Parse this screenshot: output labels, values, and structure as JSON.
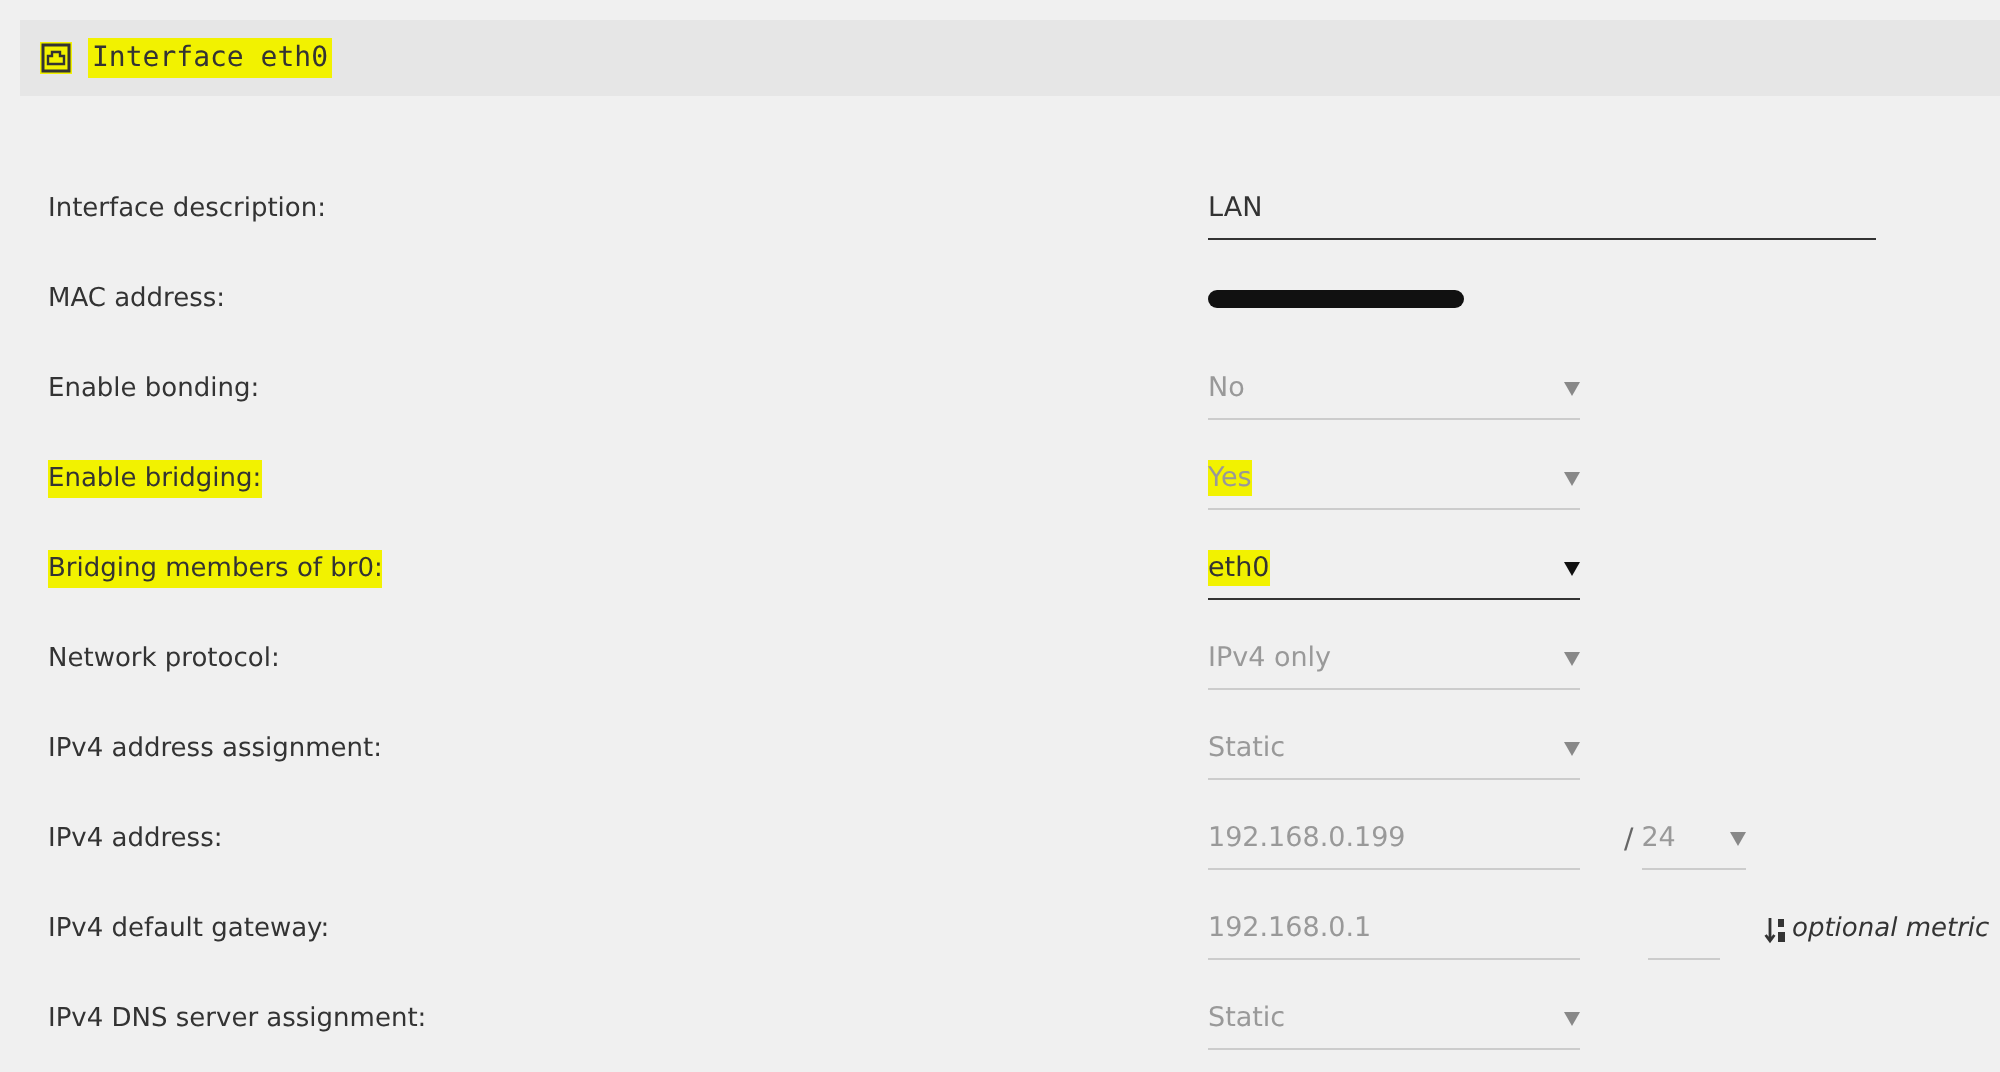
{
  "header": {
    "title": "Interface eth0",
    "highlighted": true
  },
  "rows": [
    {
      "label": "Interface description:",
      "highlighted": false,
      "kind": "text",
      "value": "LAN",
      "wide": true,
      "disabled": false
    },
    {
      "label": "MAC address:",
      "highlighted": false,
      "kind": "redacted"
    },
    {
      "label": "Enable bonding:",
      "highlighted": false,
      "kind": "select",
      "value": "No",
      "disabled": true
    },
    {
      "label": "Enable bridging:",
      "highlighted": true,
      "kind": "select",
      "value": "Yes",
      "disabled": true
    },
    {
      "label": "Bridging members of br0:",
      "highlighted": true,
      "kind": "select",
      "value": "eth0",
      "disabled": false
    },
    {
      "label": "Network protocol:",
      "highlighted": false,
      "kind": "select",
      "value": "IPv4 only",
      "disabled": true
    },
    {
      "label": "IPv4 address assignment:",
      "highlighted": false,
      "kind": "select",
      "value": "Static",
      "disabled": true
    },
    {
      "label": "IPv4 address:",
      "highlighted": false,
      "kind": "address",
      "value": "192.168.0.199",
      "disabled": true,
      "separator": "/",
      "prefix": "24"
    },
    {
      "label": "IPv4 default gateway:",
      "highlighted": false,
      "kind": "gateway",
      "value": "192.168.0.1",
      "disabled": true,
      "hint": "optional metric"
    },
    {
      "label": "IPv4 DNS server assignment:",
      "highlighted": false,
      "kind": "select",
      "value": "Static",
      "disabled": true
    }
  ]
}
